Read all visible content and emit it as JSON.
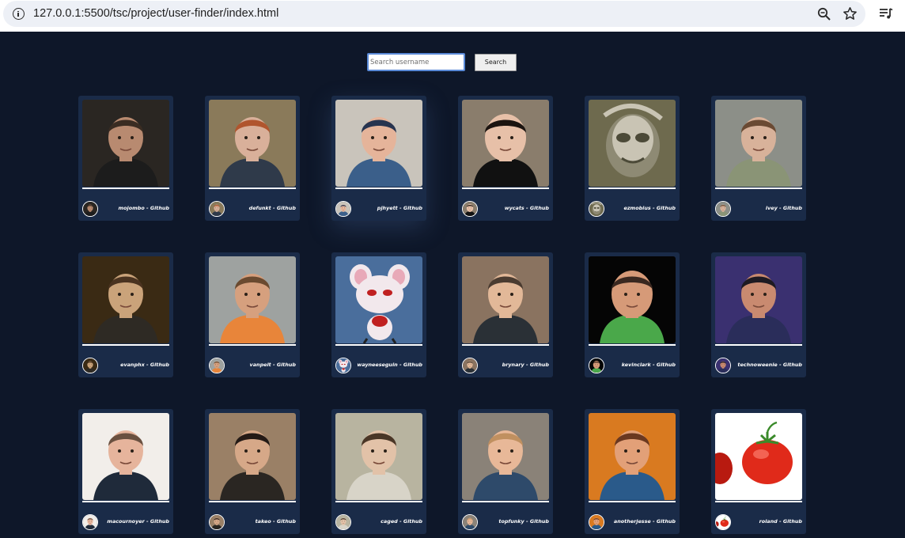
{
  "browser": {
    "url": "127.0.0.1:5500/tsc/project/user-finder/index.html",
    "icons": [
      "info-icon",
      "zoom-icon",
      "star-icon",
      "reading-list-icon"
    ]
  },
  "search": {
    "placeholder": "Search username",
    "value": "",
    "button_label": "Search"
  },
  "colors": {
    "page_background": "#0e1729",
    "card_background": "#1a2b48",
    "text": "#ffffff",
    "search_focus_border": "#5a8ad8"
  },
  "suffix": " - Github",
  "users": [
    {
      "login": "mojombo",
      "caption": "mojombo - Github",
      "palette": [
        "#2a2622",
        "#b88a70",
        "#3a2c22",
        "#1c1c1c"
      ]
    },
    {
      "login": "defunkt",
      "caption": "defunkt - Github",
      "palette": [
        "#8a7a5a",
        "#d9b09a",
        "#b0552e",
        "#2f3a4a"
      ]
    },
    {
      "login": "pjhyett",
      "caption": "pjhyett - Github",
      "palette": [
        "#c9c4bb",
        "#e5b49a",
        "#27344f",
        "#3b5f8a"
      ]
    },
    {
      "login": "wycats",
      "caption": "wycats - Github",
      "palette": [
        "#8a7d6c",
        "#e7c0a8",
        "#1b1410",
        "#111111"
      ]
    },
    {
      "login": "ezmobius",
      "caption": "ezmobius - Github",
      "palette": [
        "#6e6a4e",
        "#c9c4b4",
        "#8e8a74",
        "#4c4a38"
      ]
    },
    {
      "login": "ivey",
      "caption": "ivey - Github",
      "palette": [
        "#8c8f88",
        "#d8b29a",
        "#6a4a33",
        "#8a9476"
      ]
    },
    {
      "login": "evanphx",
      "caption": "evanphx - Github",
      "palette": [
        "#3a2a14",
        "#caa37a",
        "#4a3320",
        "#2e2a24"
      ]
    },
    {
      "login": "vanpelt",
      "caption": "vanpelt - Github",
      "palette": [
        "#9ea2a0",
        "#d6a07e",
        "#6a4a30",
        "#e8853a"
      ]
    },
    {
      "login": "wayneeseguin",
      "caption": "wayneeseguin - Github",
      "palette": [
        "#4a6e9c",
        "#f2e8ec",
        "#e8a9b8",
        "#c02020"
      ]
    },
    {
      "login": "brynary",
      "caption": "brynary - Github",
      "palette": [
        "#8a7360",
        "#e2b898",
        "#4a3b30",
        "#2a3036"
      ]
    },
    {
      "login": "kevinclark",
      "caption": "kevinclark - Github",
      "palette": [
        "#050505",
        "#d69a78",
        "#3a2820",
        "#4aa84a"
      ]
    },
    {
      "login": "technoweenie",
      "caption": "technoweenie - Github",
      "palette": [
        "#3a3070",
        "#c98a70",
        "#1e1a22",
        "#2a2d5a"
      ]
    },
    {
      "login": "macournoyer",
      "caption": "macournoyer - Github",
      "palette": [
        "#f2eeea",
        "#e6b49c",
        "#6a5040",
        "#1f2a3a"
      ]
    },
    {
      "login": "takeo",
      "caption": "takeo - Github",
      "palette": [
        "#9a8066",
        "#d6a888",
        "#241a16",
        "#2a2622"
      ]
    },
    {
      "login": "caged",
      "caption": "caged - Github",
      "palette": [
        "#b8b4a0",
        "#e2c2a8",
        "#4a3626",
        "#d8d4c8"
      ]
    },
    {
      "login": "topfunky",
      "caption": "topfunky - Github",
      "palette": [
        "#8a8278",
        "#e8b898",
        "#c09060",
        "#2e4a6a"
      ]
    },
    {
      "login": "anotherjesse",
      "caption": "anotherjesse - Github",
      "palette": [
        "#d97a20",
        "#e2a078",
        "#6a3820",
        "#2a5a8a"
      ]
    },
    {
      "login": "roland",
      "caption": "roland - Github",
      "palette": [
        "#ffffff",
        "#e02a1a",
        "#b81a10",
        "#3a8a2a"
      ]
    }
  ]
}
